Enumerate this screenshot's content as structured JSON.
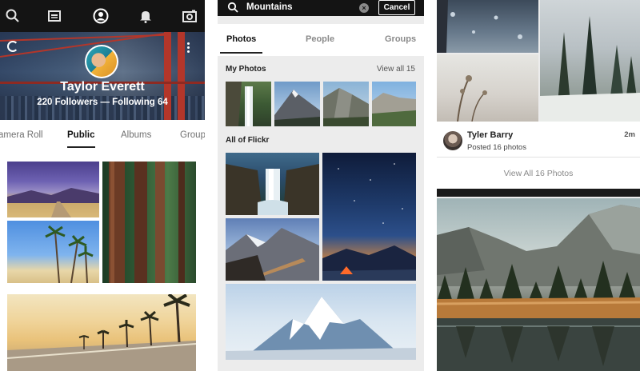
{
  "profile_screen": {
    "nav_icons": [
      "search-icon",
      "photostream-icon",
      "profile-icon",
      "notifications-icon",
      "camera-icon"
    ],
    "name": "Taylor Everett",
    "stats": "220 Followers — Following 64",
    "tabs": [
      "amera Roll",
      "Public",
      "Albums",
      "Group"
    ],
    "active_tab": "Public"
  },
  "search_screen": {
    "query": "Mountains",
    "clear_symbol": "×",
    "cancel_label": "Cancel",
    "tabs": [
      "Photos",
      "People",
      "Groups"
    ],
    "active_tab": "Photos",
    "my_photos_label": "My Photos",
    "view_all_label": "View all 15",
    "all_flickr_label": "All of Flickr"
  },
  "feed_screen": {
    "user_name": "Tyler Barry",
    "posted_text": "Posted 16 photos",
    "time_ago": "2m",
    "view_all_label": "View All 16 Photos"
  },
  "colors": {
    "topbar": "#141414",
    "panel_bg": "#ececec",
    "bridge_red": "#b3362a"
  }
}
